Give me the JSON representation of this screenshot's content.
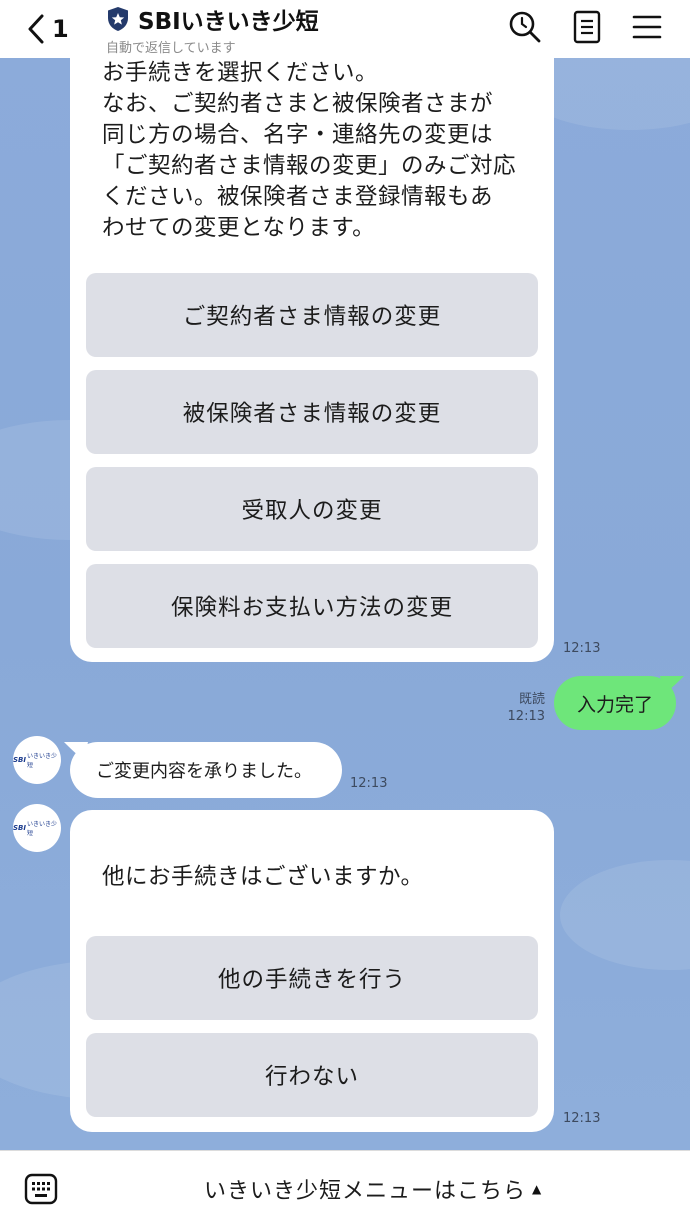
{
  "header": {
    "back_count": "1",
    "title": "SBIいきいき少短",
    "subtitle": "自動で返信しています"
  },
  "card1": {
    "text": "お手続きを選択ください。\nなお、ご契約者さまと被保険者さまが\n同じ方の場合、名字・連絡先の変更は\n「ご契約者さま情報の変更」のみご対応\nください。被保険者さま登録情報もあ\nわせての変更となります。",
    "buttons": [
      "ご契約者さま情報の変更",
      "被保険者さま情報の変更",
      "受取人の変更",
      "保険料お支払い方法の変更"
    ],
    "time": "12:13"
  },
  "user_message": {
    "text": "入力完了",
    "read_label": "既読",
    "time": "12:13"
  },
  "bot_message": {
    "text": "ご変更内容を承りました。",
    "time": "12:13"
  },
  "card2": {
    "text": "他にお手続きはございますか。",
    "buttons": [
      "他の手続きを行う",
      "行わない"
    ],
    "time": "12:13"
  },
  "avatar": {
    "logo_text": "SBI",
    "logo_name": "いきいき少短"
  },
  "footer": {
    "menu_label": "いきいき少短メニューはこちら",
    "caret": "▲"
  },
  "colors": {
    "chat_background": "#8aabd9",
    "user_bubble": "#6ee67a",
    "button_bg": "#dddfe6"
  }
}
